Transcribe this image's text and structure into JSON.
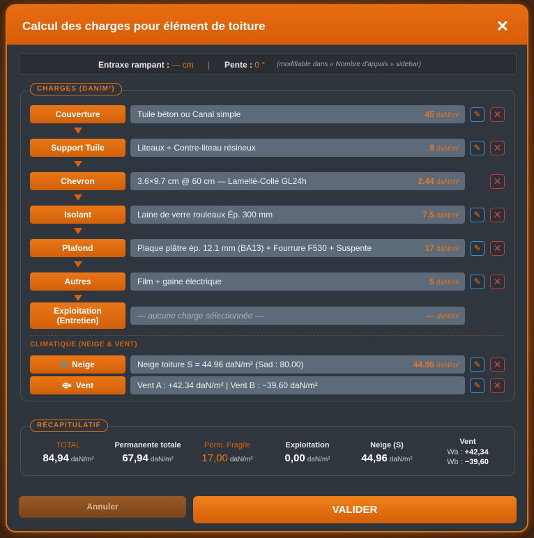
{
  "header": {
    "title": "Calcul des charges pour élément de toiture",
    "close": "✕"
  },
  "info": {
    "entraxe_label": "Entraxe rampant :",
    "entraxe_value": "— cm",
    "separator": "|",
    "pente_label": "Pente :",
    "pente_value": "0 °",
    "hint": "(modifiable dans « Nombre d'appuis » sidebar)"
  },
  "charges": {
    "section_label": "CHARGES (DAN/M²)",
    "rows": [
      {
        "category": "Couverture",
        "value": "Tuile béton ou Canal simple",
        "load": "45",
        "unit": "daN/m²",
        "editable": true
      },
      {
        "category": "Support Tuile",
        "value": "Liteaux + Contre-liteau résineux",
        "load": "8",
        "unit": "daN/m²",
        "editable": true
      },
      {
        "category": "Chevron",
        "value": "3.6×9.7 cm @ 60 cm — Lamellé-Collé GL24h",
        "load": "2.44",
        "unit": "daN/m²",
        "editable": false
      },
      {
        "category": "Isolant",
        "value": "Laine de verre rouleaux Ép. 300 mm",
        "load": "7.5",
        "unit": "daN/m²",
        "editable": true
      },
      {
        "category": "Plafond",
        "value": "Plaque plâtre ép. 12.1 mm (BA13) + Fourrure F530 + Suspente",
        "load": "17",
        "unit": "daN/m²",
        "editable": true
      },
      {
        "category": "Autres",
        "value": "Film + gaine électrique",
        "load": "5",
        "unit": "daN/m²",
        "editable": true
      }
    ],
    "exploitation": {
      "category_line1": "Exploitation",
      "category_line2": "(Entretien)",
      "value": "— aucune charge sélectionnée —",
      "load": "—",
      "unit": "daN/m²"
    }
  },
  "climatique": {
    "label": "CLIMATIQUE (NEIGE & VENT)",
    "neige": {
      "category": "Neige",
      "value": "Neige toiture S = 44.96 daN/m² (Sad : 80.00)",
      "load": "44.96",
      "unit": "daN/m²"
    },
    "vent": {
      "category": "Vent",
      "value": "Vent A : +42.34 daN/m² | Vent B : −39.60 daN/m²"
    }
  },
  "recap": {
    "section_label": "RÉCAPITULATIF",
    "unit": "daN/m²",
    "total": {
      "label": "TOTAL",
      "value": "84,94"
    },
    "permanente": {
      "label": "Permanente totale",
      "value": "67,94"
    },
    "fragile": {
      "label": "Perm. Fragile",
      "value": "17,00"
    },
    "exploitation": {
      "label": "Exploitation",
      "value": "0,00"
    },
    "neige": {
      "label": "Neige (S)",
      "value": "44,96"
    },
    "vent": {
      "label": "Vent",
      "wa_label": "Wa :",
      "wa": "+42,34",
      "wb_label": "Wb :",
      "wb": "−39,60"
    }
  },
  "footer": {
    "cancel": "Annuler",
    "ok": "VALIDER"
  },
  "colors": {
    "accent": "#e8751a",
    "danger": "#d44444",
    "edit": "#3d8fd8"
  }
}
